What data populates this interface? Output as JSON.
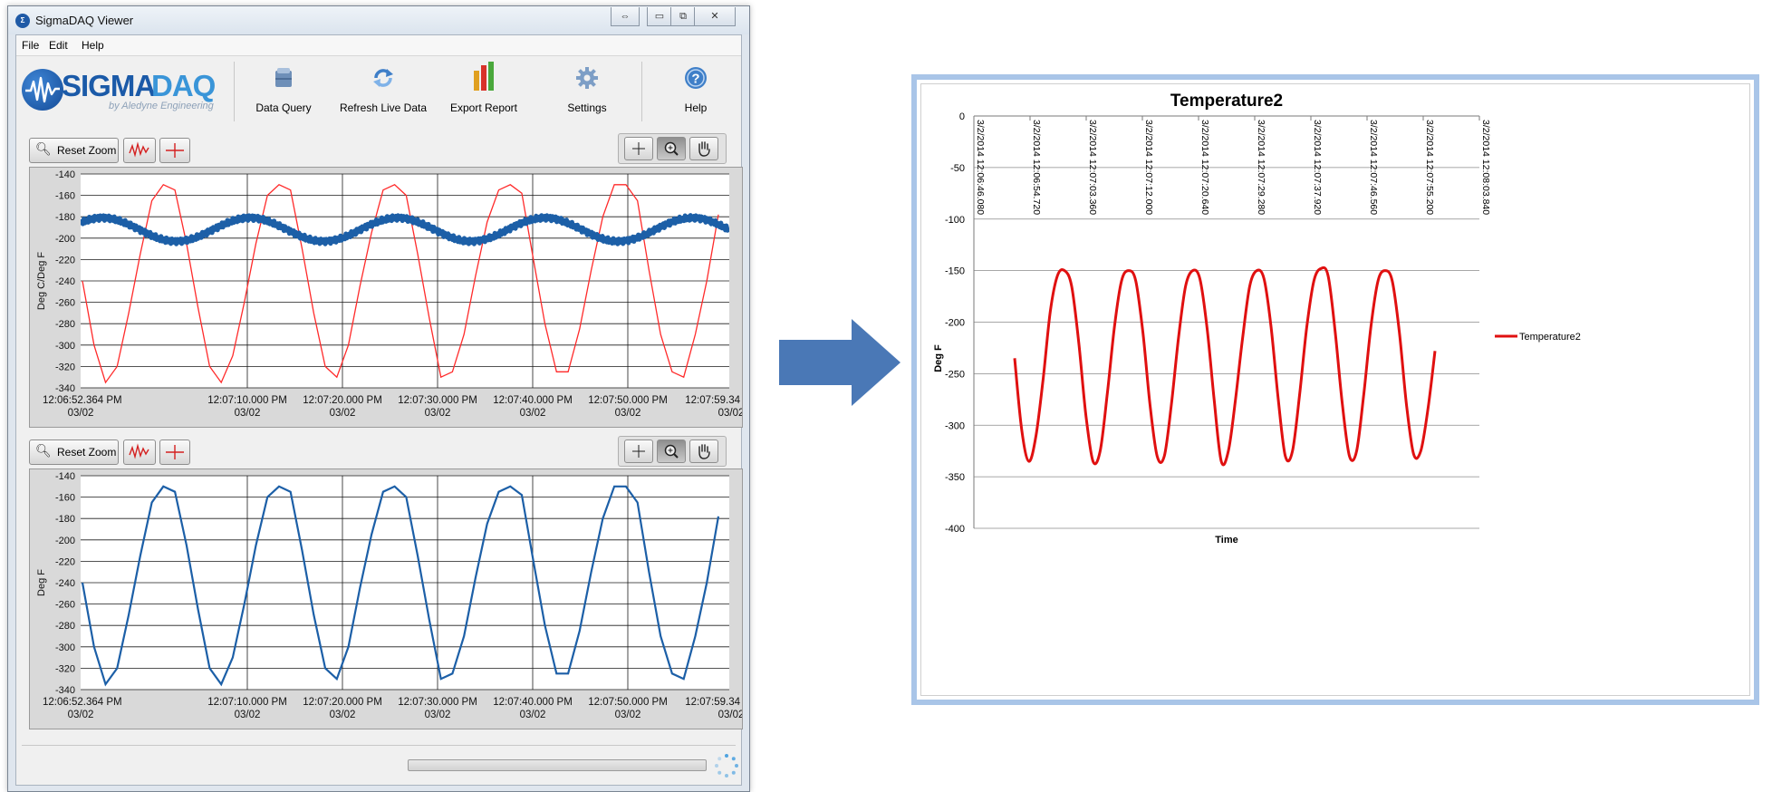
{
  "window": {
    "title": "SigmaDAQ Viewer",
    "buttons": {
      "restore": "⇔",
      "minimize": "▭",
      "maximize": "⧉",
      "close": "✕"
    }
  },
  "menu": [
    "File",
    "Edit",
    "Help"
  ],
  "logo": {
    "primary": "SIGMA",
    "secondary": "DAQ",
    "subtitle": "by Aledyne Engineering"
  },
  "toolbar": [
    {
      "label": "Data Query",
      "icon": "database-icon"
    },
    {
      "label": "Refresh Live Data",
      "icon": "refresh-icon"
    },
    {
      "label": "Export Report",
      "icon": "report-icon"
    },
    {
      "label": "Settings",
      "icon": "gear-icon"
    },
    {
      "label": "Help",
      "icon": "help-icon"
    }
  ],
  "chart_controls": {
    "reset_zoom": "Reset Zoom"
  },
  "colors": {
    "red": "#ff2a2a",
    "blue": "#1c5fa7",
    "excel_red": "#e01010",
    "brand": "#1b5aa8",
    "arrow": "#4a78b6"
  },
  "chart_data": [
    {
      "type": "line",
      "title": "",
      "ylabel": "Deg C/Deg F",
      "yticks": [
        -140,
        -160,
        -180,
        -200,
        -220,
        -240,
        -260,
        -280,
        -300,
        -320,
        -340
      ],
      "ylim": [
        -340,
        -140
      ],
      "xticks": [
        {
          "time": "12:06:52.364 PM",
          "date": "03/02"
        },
        {
          "time": "12:07:10.000 PM",
          "date": "03/02"
        },
        {
          "time": "12:07:20.000 PM",
          "date": "03/02"
        },
        {
          "time": "12:07:30.000 PM",
          "date": "03/02"
        },
        {
          "time": "12:07:40.000 PM",
          "date": "03/02"
        },
        {
          "time": "12:07:50.000 PM",
          "date": "03/02"
        },
        {
          "time": "12:07:59.34",
          "date": "03/02"
        }
      ],
      "series": [
        {
          "color": "#ff2a2a",
          "values": [
            -240,
            -300,
            -335,
            -320,
            -270,
            -215,
            -165,
            -150,
            -155,
            -205,
            -265,
            -320,
            -335,
            -310,
            -260,
            -205,
            -160,
            -150,
            -155,
            -210,
            -270,
            -320,
            -330,
            -300,
            -245,
            -195,
            -155,
            -150,
            -160,
            -215,
            -275,
            -330,
            -325,
            -290,
            -235,
            -185,
            -155,
            -150,
            -158,
            -220,
            -280,
            -325,
            -325,
            -285,
            -230,
            -180,
            -150,
            -150,
            -165,
            -230,
            -290,
            -325,
            -330,
            -290,
            -240,
            -178
          ]
        },
        {
          "color": "#1c5fa7",
          "period_s": 15.5,
          "mean": -192,
          "amplitude": 11
        }
      ]
    },
    {
      "type": "line",
      "title": "",
      "ylabel": "Deg F",
      "yticks": [
        -140,
        -160,
        -180,
        -200,
        -220,
        -240,
        -260,
        -280,
        -300,
        -320,
        -340
      ],
      "ylim": [
        -340,
        -140
      ],
      "xticks": [
        {
          "time": "12:06:52.364 PM",
          "date": "03/02"
        },
        {
          "time": "12:07:10.000 PM",
          "date": "03/02"
        },
        {
          "time": "12:07:20.000 PM",
          "date": "03/02"
        },
        {
          "time": "12:07:30.000 PM",
          "date": "03/02"
        },
        {
          "time": "12:07:40.000 PM",
          "date": "03/02"
        },
        {
          "time": "12:07:50.000 PM",
          "date": "03/02"
        },
        {
          "time": "12:07:59.34",
          "date": "03/02"
        }
      ],
      "series": [
        {
          "color": "#1c5fa7",
          "values": [
            -240,
            -300,
            -335,
            -320,
            -270,
            -215,
            -165,
            -150,
            -155,
            -205,
            -265,
            -320,
            -335,
            -310,
            -260,
            -205,
            -160,
            -150,
            -155,
            -210,
            -270,
            -320,
            -330,
            -300,
            -245,
            -195,
            -155,
            -150,
            -160,
            -215,
            -275,
            -330,
            -325,
            -290,
            -235,
            -185,
            -155,
            -150,
            -158,
            -220,
            -280,
            -325,
            -325,
            -285,
            -230,
            -180,
            -150,
            -150,
            -165,
            -230,
            -290,
            -325,
            -330,
            -290,
            -240,
            -178
          ]
        }
      ]
    },
    {
      "type": "line",
      "title": "Temperature2",
      "xlabel": "Time",
      "ylabel": "Deg F",
      "yticks": [
        0,
        -50,
        -100,
        -150,
        -200,
        -250,
        -300,
        -350,
        -400
      ],
      "ylim": [
        -400,
        0
      ],
      "xticks": [
        "3/2/2014 12:06:46.080",
        "3/2/2014 12:06:54.720",
        "3/2/2014 12:07:03.360",
        "3/2/2014 12:07:12.000",
        "3/2/2014 12:07:20.640",
        "3/2/2014 12:07:29.280",
        "3/2/2014 12:07:37.920",
        "3/2/2014 12:07:46.560",
        "3/2/2014 12:07:55.200",
        "3/2/2014 12:08:03.840"
      ],
      "legend": "right",
      "series": [
        {
          "name": "Temperature2",
          "color": "#e01010",
          "values": [
            -235,
            -305,
            -335,
            -310,
            -255,
            -190,
            -155,
            -150,
            -165,
            -220,
            -290,
            -335,
            -325,
            -270,
            -205,
            -160,
            -150,
            -160,
            -210,
            -280,
            -330,
            -330,
            -280,
            -215,
            -165,
            -150,
            -158,
            -205,
            -275,
            -335,
            -325,
            -275,
            -215,
            -165,
            -150,
            -158,
            -205,
            -275,
            -330,
            -325,
            -270,
            -205,
            -160,
            -148,
            -155,
            -210,
            -280,
            -330,
            -325,
            -270,
            -205,
            -160,
            -150,
            -160,
            -210,
            -280,
            -328,
            -325,
            -285,
            -228
          ]
        }
      ]
    }
  ]
}
